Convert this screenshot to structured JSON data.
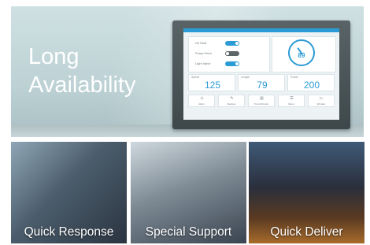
{
  "hero": {
    "title_line1": "Long",
    "title_line2": "Availability",
    "device": {
      "brand": "",
      "clock": "",
      "toggles": [
        {
          "label": "Oil Heat",
          "state": "on"
        },
        {
          "label": "Pump Feed",
          "state": "off"
        },
        {
          "label": "Light Valve",
          "state": "on"
        }
      ],
      "gauge": {
        "value": "89",
        "unit": "",
        "level_percent": 89
      },
      "stats": [
        {
          "label": "Speed",
          "value": "125"
        },
        {
          "label": "Length",
          "value": "79"
        },
        {
          "label": "Power",
          "value": "200"
        }
      ],
      "buttons": [
        {
          "label": "Alarm",
          "icon": "warning-icon"
        },
        {
          "label": "Recipes",
          "icon": "wrench-icon"
        },
        {
          "label": "Trend Monitor",
          "icon": "chart-icon"
        },
        {
          "label": "Menu",
          "icon": "menu-icon"
        },
        {
          "label": "Window",
          "icon": "play-icon"
        }
      ]
    }
  },
  "tiles": [
    {
      "caption": "Quick Response",
      "image": "customer-support-agents-photo"
    },
    {
      "caption": "Special Support",
      "image": "technician-at-workbench-photo"
    },
    {
      "caption": "Quick Deliver",
      "image": "city-highway-light-trails-photo"
    }
  ]
}
